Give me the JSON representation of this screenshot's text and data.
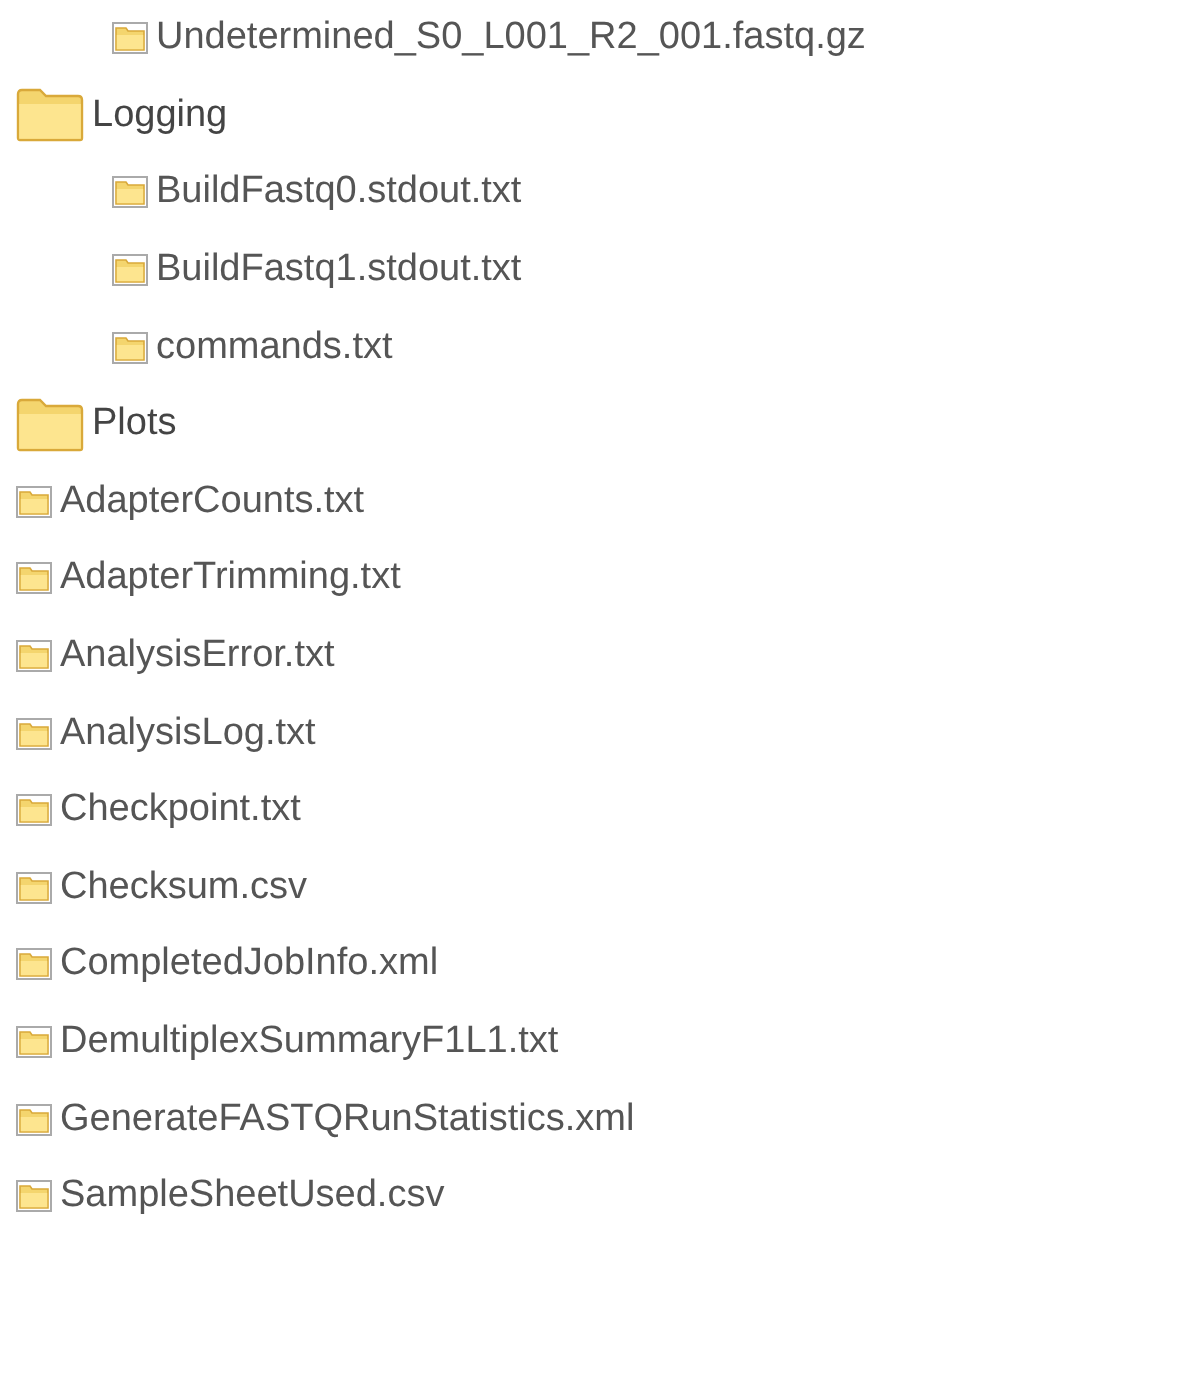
{
  "tree_continuation": [
    {
      "kind": "file",
      "label": "Undetermined_S0_L001_R2_001.fastq.gz"
    }
  ],
  "tree": [
    {
      "kind": "folder",
      "label": "Logging",
      "children": [
        {
          "kind": "file",
          "label": "BuildFastq0.stdout.txt"
        },
        {
          "kind": "file",
          "label": "BuildFastq1.stdout.txt"
        },
        {
          "kind": "file",
          "label": "commands.txt"
        }
      ]
    },
    {
      "kind": "folder",
      "label": "Plots"
    },
    {
      "kind": "file",
      "label": "AdapterCounts.txt"
    },
    {
      "kind": "file",
      "label": "AdapterTrimming.txt"
    },
    {
      "kind": "file",
      "label": "AnalysisError.txt"
    },
    {
      "kind": "file",
      "label": "AnalysisLog.txt"
    },
    {
      "kind": "file",
      "label": "Checkpoint.txt"
    },
    {
      "kind": "file",
      "label": "Checksum.csv"
    },
    {
      "kind": "file",
      "label": "CompletedJobInfo.xml"
    },
    {
      "kind": "file",
      "label": "DemultiplexSummaryF1L1.txt"
    },
    {
      "kind": "file",
      "label": "GenerateFASTQRunStatistics.xml"
    },
    {
      "kind": "file",
      "label": "SampleSheetUsed.csv"
    }
  ]
}
